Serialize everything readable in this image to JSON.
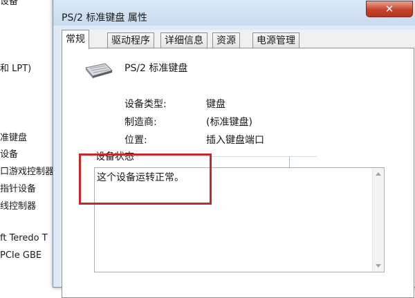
{
  "background_list": {
    "items": [
      "设备",
      "和 LPT)",
      "准键盘",
      "设备",
      "口游戏控制器",
      "指针设备",
      "线控制器",
      "ft Teredo T",
      "PCIe GBE "
    ]
  },
  "dialog": {
    "title": "PS/2 标准键盘 属性",
    "close_label": "✕",
    "tabs": [
      {
        "label": "常规",
        "active": true
      },
      {
        "label": "驱动程序",
        "active": false
      },
      {
        "label": "详细信息",
        "active": false
      },
      {
        "label": "资源",
        "active": false
      },
      {
        "label": "电源管理",
        "active": false
      }
    ],
    "device_icon": "keyboard-icon",
    "device_name": "PS/2 标准键盘",
    "properties": [
      {
        "label": "设备类型:",
        "value": "键盘"
      },
      {
        "label": "制造商:",
        "value": "(标准键盘)"
      },
      {
        "label": "位置:",
        "value": "插入键盘端口"
      }
    ],
    "status_group": {
      "legend": "设备状态",
      "text": "这个设备运转正常。"
    }
  },
  "colors": {
    "highlight": "#c8262b",
    "close_button": "#c7432b",
    "frame": "#dfe9f5"
  }
}
